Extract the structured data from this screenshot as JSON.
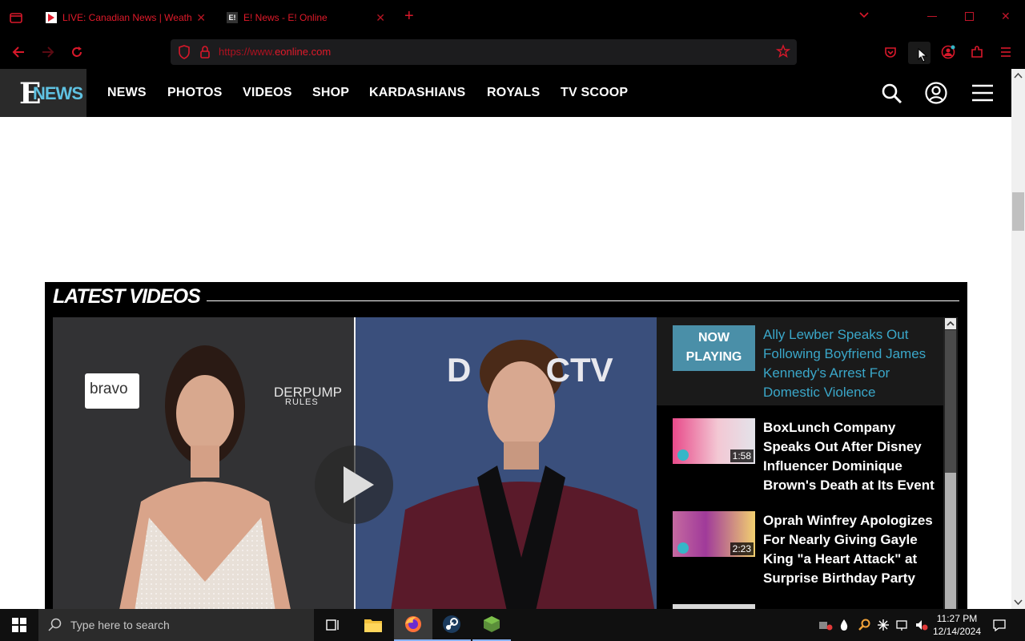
{
  "browser": {
    "tabs": [
      {
        "title": "LIVE: Canadian News | Weather"
      },
      {
        "title": "E! News - E! Online"
      }
    ],
    "new_tab_label": "+",
    "url_prefix": "https://www.",
    "url_domain": "eonline.com"
  },
  "site": {
    "logo_letter": "E",
    "logo_word": "NEWS",
    "nav": [
      "NEWS",
      "PHOTOS",
      "VIDEOS",
      "SHOP",
      "KARDASHIANS",
      "ROYALS",
      "TV SCOOP"
    ]
  },
  "latest_videos": {
    "heading": "LATEST VIDEOS",
    "player_brand_left": "bravo",
    "player_brand_show": "DERPUMP",
    "player_brand_show2": "RULES",
    "player_brand_right": "D        CTV",
    "items": [
      {
        "title": "Ally Lewber Speaks Out Following Boyfriend James Kennedy's Arrest For Domestic Violence",
        "badge": "NOW PLAYING",
        "duration": ""
      },
      {
        "title": "BoxLunch Company Speaks Out After Disney Influencer Dominique Brown's Death at Its Event",
        "badge": "",
        "duration": "1:58"
      },
      {
        "title": "Oprah Winfrey Apologizes For Nearly Giving Gayle King \"a Heart Attack\" at Surprise Birthday Party",
        "badge": "",
        "duration": "2:23"
      }
    ]
  },
  "taskbar": {
    "search_placeholder": "Type here to search",
    "time": "11:27 PM",
    "date": "12/14/2024"
  },
  "colors": {
    "browser_accent": "#e01a2a",
    "now_playing_text": "#3aa7c9",
    "site_header": "#000000"
  }
}
